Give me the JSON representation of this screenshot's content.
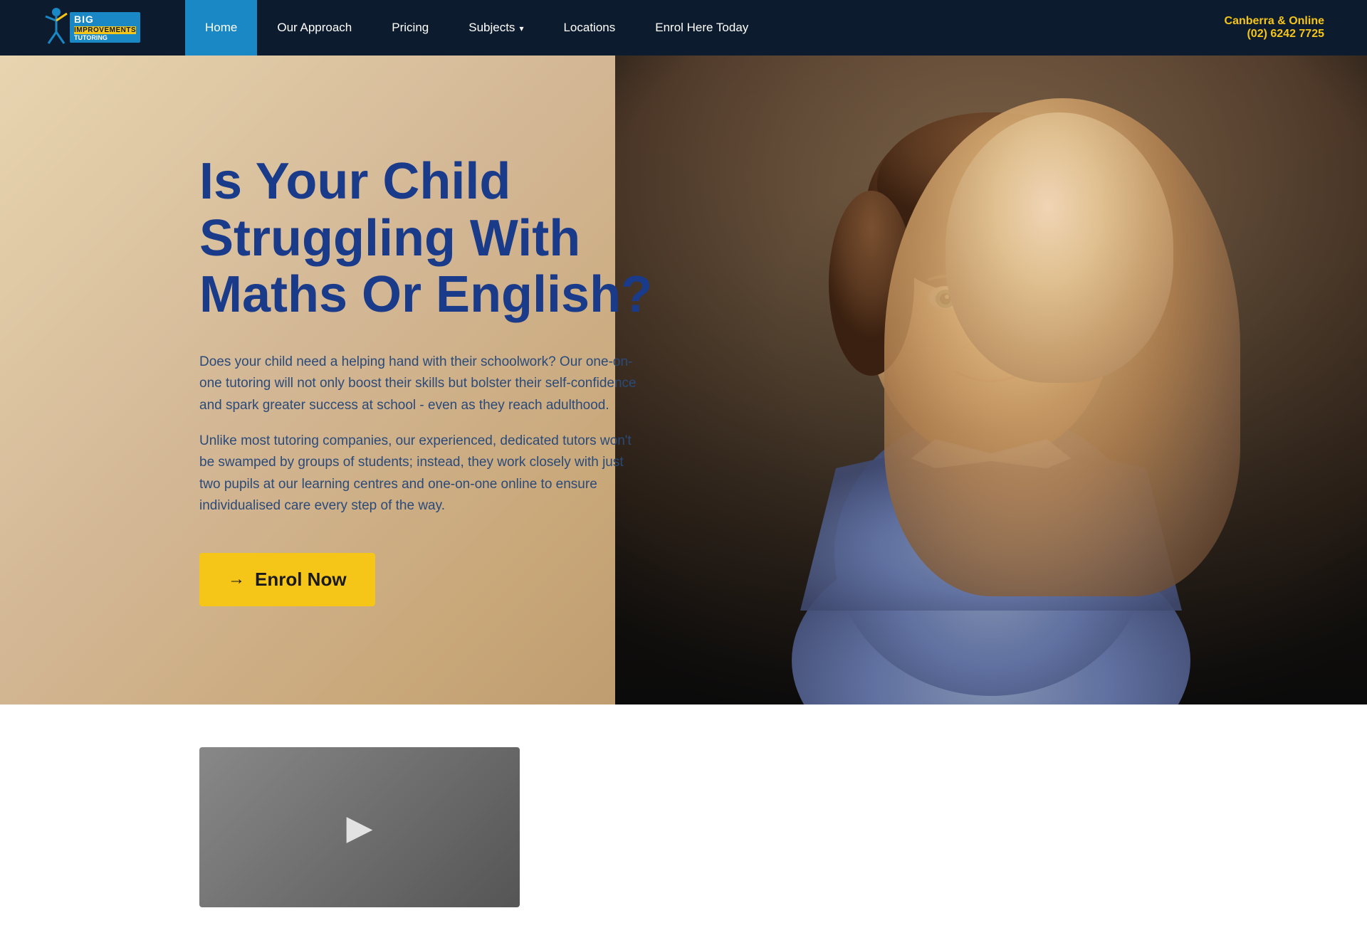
{
  "header": {
    "logo": {
      "big_label": "BIG",
      "improvements_label": "IMPROVEMENTS",
      "tutoring_label": "TUTORING"
    },
    "nav": [
      {
        "id": "home",
        "label": "Home",
        "active": true
      },
      {
        "id": "our-approach",
        "label": "Our Approach",
        "active": false
      },
      {
        "id": "pricing",
        "label": "Pricing",
        "active": false
      },
      {
        "id": "subjects",
        "label": "Subjects",
        "active": false,
        "has_dropdown": true
      },
      {
        "id": "locations",
        "label": "Locations",
        "active": false
      },
      {
        "id": "enrol-here-today",
        "label": "Enrol Here Today",
        "active": false
      }
    ],
    "contact": {
      "location": "Canberra & Online",
      "phone": "(02) 6242 7725"
    }
  },
  "hero": {
    "heading": "Is Your Child Struggling With Maths Or English?",
    "body1": "Does your child need a helping hand with their schoolwork? Our one-on-one tutoring will not only boost their skills but bolster their self-confidence and spark greater success at school - even as they reach adulthood.",
    "body2": "Unlike most tutoring companies, our experienced, dedicated tutors won't be swamped by groups of students; instead, they work closely with just two pupils at our learning centres and one-on-one online to ensure individualised care every step of the way.",
    "enrol_button": "Enrol Now"
  },
  "icons": {
    "arrow_right": "→",
    "chevron_down": "▾",
    "person_figure": "🧍"
  }
}
